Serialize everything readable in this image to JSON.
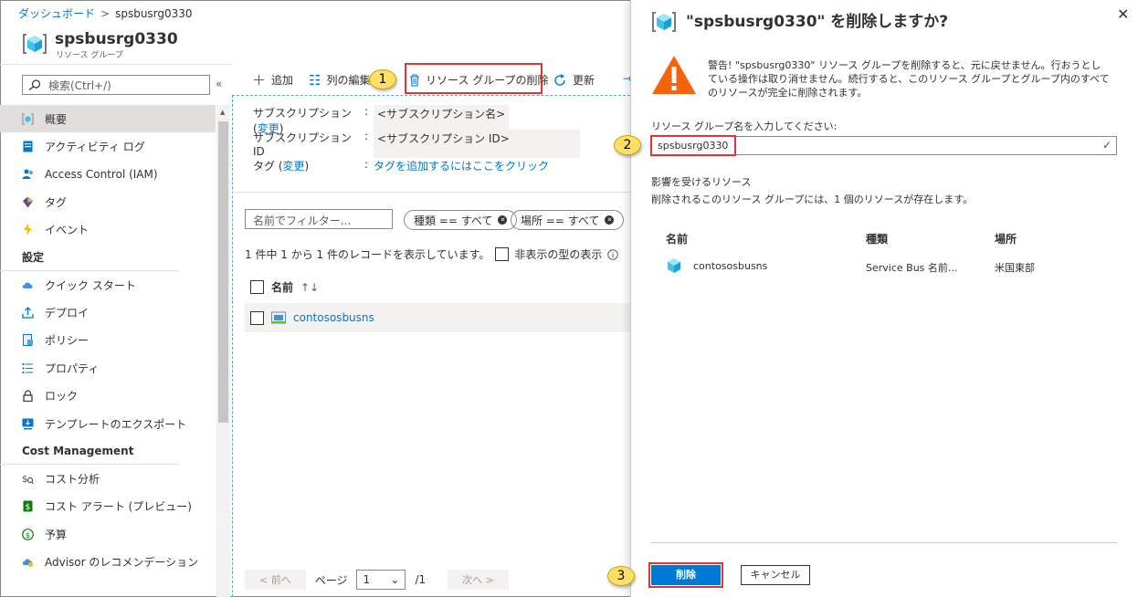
{
  "breadcrumb": {
    "home": "ダッシュボード",
    "separator": ">",
    "current": "spsbusrg0330"
  },
  "resource": {
    "title": "spsbusrg0330",
    "subtitle": "リソース グループ"
  },
  "search": {
    "placeholder": "検索(Ctrl+/)"
  },
  "sidebar": {
    "items": [
      {
        "label": "概要",
        "icon": "resource-group-icon",
        "active": true
      },
      {
        "label": "アクティビティ ログ",
        "icon": "activity-log-icon"
      },
      {
        "label": "Access Control (IAM)",
        "icon": "iam-icon"
      },
      {
        "label": "タグ",
        "icon": "tag-icon"
      },
      {
        "label": "イベント",
        "icon": "lightning-icon"
      }
    ],
    "settings_heading": "設定",
    "settings_items": [
      {
        "label": "クイック スタート",
        "icon": "cloud-icon"
      },
      {
        "label": "デプロイ",
        "icon": "upload-icon"
      },
      {
        "label": "ポリシー",
        "icon": "policy-icon"
      },
      {
        "label": "プロパティ",
        "icon": "properties-icon"
      },
      {
        "label": "ロック",
        "icon": "lock-icon"
      },
      {
        "label": "テンプレートのエクスポート",
        "icon": "export-icon"
      }
    ],
    "cost_heading": "Cost Management",
    "cost_items": [
      {
        "label": "コスト分析",
        "icon": "cost-analysis-icon"
      },
      {
        "label": "コスト アラート (プレビュー)",
        "icon": "dollar-icon"
      },
      {
        "label": "予算",
        "icon": "budget-icon"
      },
      {
        "label": "Advisor のレコメンデーション",
        "icon": "advisor-icon"
      }
    ]
  },
  "toolbar": {
    "add": "追加",
    "columns": "列の編集",
    "delete_rg": "リソース グループの削除",
    "refresh": "更新"
  },
  "essentials": {
    "subscription_label": "サブスクリプション",
    "change_link": "変更",
    "subscription_value": "<サブスクリプション名>",
    "subscription_id_label": "サブスクリプション ID",
    "subscription_id_value": "<サブスクリプション ID>",
    "tags_label": "タグ",
    "tags_link": "タグを追加するにはここをクリック"
  },
  "filter": {
    "placeholder": "名前でフィルター...",
    "type_pill": "種類 == すべて",
    "location_pill": "場所 == すべて",
    "records": "1 件中 1 から 1 件のレコードを表示しています。",
    "show_hidden": "非表示の型の表示"
  },
  "table": {
    "name_header": "名前",
    "rows": [
      {
        "name": "contososbusns"
      }
    ]
  },
  "pager": {
    "prev": "< 前へ",
    "page_label": "ページ",
    "page_value": "1",
    "of": "/1",
    "next": "次へ >"
  },
  "dialog": {
    "title": "\"spsbusrg0330\" を削除しますか?",
    "warning": "警告! \"spsbusrg0330\" リソース グループを削除すると、元に戻せません。行おうとしている操作は取り消せません。続行すると、このリソース グループとグループ内のすべてのリソースが完全に削除されます。",
    "confirm_label": "リソース グループ名を入力してください:",
    "confirm_value": "spsbusrg0330",
    "affected_title": "影響を受けるリソース",
    "affected_desc": "削除されるこのリソース グループには、1 個のリソースが存在します。",
    "columns": {
      "name": "名前",
      "type": "種類",
      "location": "場所"
    },
    "rows": [
      {
        "name": "contososbusns",
        "type": "Service Bus 名前...",
        "location": "米国東部"
      }
    ],
    "delete_button": "削除",
    "cancel_button": "キャンセル"
  },
  "callouts": [
    "1",
    "2",
    "3"
  ],
  "colors": {
    "accent": "#0078d4",
    "highlight": "#e3342f",
    "callout": "#ffe066",
    "warning": "#f7630c"
  }
}
